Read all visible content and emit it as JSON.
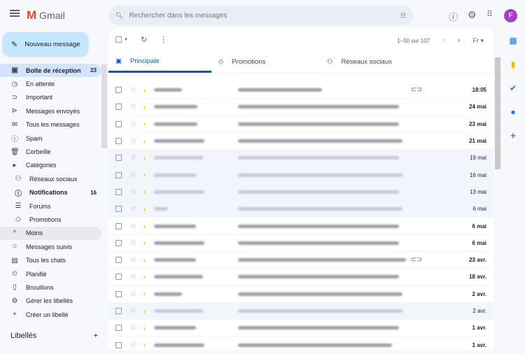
{
  "app": {
    "name": "Gmail",
    "logo_letter": "M"
  },
  "search": {
    "placeholder": "Rechercher dans les messages"
  },
  "account": {
    "initial": "F"
  },
  "compose": {
    "label": "Nouveau message"
  },
  "sidebar": {
    "items": [
      {
        "label": "Boîte de réception",
        "count": "23",
        "icon": "inbox-icon",
        "glyph": "▣"
      },
      {
        "label": "En attente",
        "count": "",
        "icon": "clock-icon",
        "glyph": "◷"
      },
      {
        "label": "Important",
        "count": "",
        "icon": "important-icon",
        "glyph": "⊃"
      },
      {
        "label": "Messages envoyés",
        "count": "",
        "icon": "send-icon",
        "glyph": "⊳"
      },
      {
        "label": "Tous les messages",
        "count": "",
        "icon": "all-mail-icon",
        "glyph": "✉"
      },
      {
        "label": "Spam",
        "count": "",
        "icon": "spam-icon",
        "glyph": "ⓘ"
      },
      {
        "label": "Corbeille",
        "count": "",
        "icon": "trash-icon",
        "glyph": "🗑"
      },
      {
        "label": "Catégories",
        "count": "",
        "icon": "label-icon",
        "glyph": "▸"
      },
      {
        "label": "Réseaux sociaux",
        "count": "",
        "icon": "people-icon",
        "glyph": "⚇"
      },
      {
        "label": "Notifications",
        "count": "16",
        "icon": "info-icon",
        "glyph": "ⓘ"
      },
      {
        "label": "Forums",
        "count": "",
        "icon": "forum-icon",
        "glyph": "☰"
      },
      {
        "label": "Promotions",
        "count": "",
        "icon": "tag-icon",
        "glyph": "◇"
      },
      {
        "label": "Moins",
        "count": "",
        "icon": "chevron-up-icon",
        "glyph": "^"
      },
      {
        "label": "Messages suivis",
        "count": "",
        "icon": "star-icon",
        "glyph": "☆"
      },
      {
        "label": "Tous les chats",
        "count": "",
        "icon": "chat-icon",
        "glyph": "▤"
      },
      {
        "label": "Planifié",
        "count": "",
        "icon": "scheduled-icon",
        "glyph": "⏲"
      },
      {
        "label": "Brouillons",
        "count": "",
        "icon": "draft-icon",
        "glyph": "▯"
      },
      {
        "label": "Gérer les libellés",
        "count": "",
        "icon": "gear-icon",
        "glyph": "⚙"
      },
      {
        "label": "Créer un libellé",
        "count": "",
        "icon": "plus-icon",
        "glyph": "+"
      }
    ],
    "labels_heading": "Libellés"
  },
  "toolbar": {
    "pagination": "1–50 sur 107",
    "lang": "Fr"
  },
  "tabs": [
    {
      "label": "Principale"
    },
    {
      "label": "Promotions"
    },
    {
      "label": "Réseaux sociaux"
    }
  ],
  "emails": [
    {
      "date": "18:05",
      "unread": true,
      "attachment": true
    },
    {
      "date": "24 mai",
      "unread": true,
      "attachment": false
    },
    {
      "date": "23 mai",
      "unread": true,
      "attachment": false
    },
    {
      "date": "21 mai",
      "unread": true,
      "attachment": false
    },
    {
      "date": "19 mai",
      "unread": false,
      "attachment": false
    },
    {
      "date": "16 mai",
      "unread": false,
      "attachment": false
    },
    {
      "date": "13 mai",
      "unread": false,
      "attachment": false
    },
    {
      "date": "6 mai",
      "unread": false,
      "attachment": false
    },
    {
      "date": "6 mai",
      "unread": true,
      "attachment": false
    },
    {
      "date": "6 mai",
      "unread": true,
      "attachment": false
    },
    {
      "date": "23 avr.",
      "unread": true,
      "attachment": true
    },
    {
      "date": "18 avr.",
      "unread": true,
      "attachment": false
    },
    {
      "date": "2 avr.",
      "unread": true,
      "attachment": false
    },
    {
      "date": "2 avr.",
      "unread": false,
      "attachment": false
    },
    {
      "date": "1 avr.",
      "unread": true,
      "attachment": false
    },
    {
      "date": "1 avr.",
      "unread": true,
      "attachment": false
    }
  ],
  "colors": {
    "accent": "#0b57d0",
    "compose_bg": "#c2e7ff",
    "avatar": "#a142c4",
    "important": "#f4b400"
  }
}
